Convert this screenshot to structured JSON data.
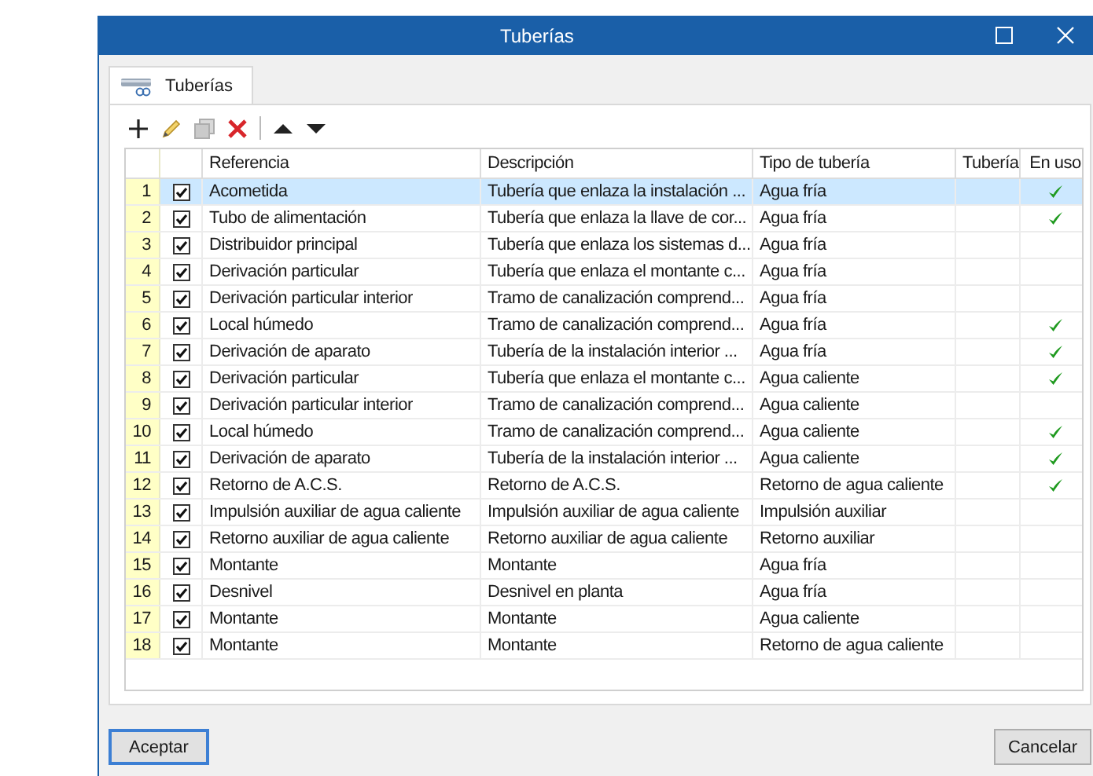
{
  "window": {
    "title": "Tuberías"
  },
  "tabs": [
    {
      "label": "Tuberías",
      "selected": true
    }
  ],
  "toolbar": [
    {
      "kind": "add",
      "disabled": false
    },
    {
      "kind": "edit",
      "disabled": false
    },
    {
      "kind": "copy",
      "disabled": true
    },
    {
      "kind": "delete",
      "disabled": false
    },
    {
      "kind": "separator"
    },
    {
      "kind": "up",
      "disabled": false
    },
    {
      "kind": "down",
      "disabled": false
    }
  ],
  "table": {
    "columns": [
      "Referencia",
      "Descripción",
      "Tipo de tubería",
      "Tubería",
      "En uso"
    ],
    "rows": [
      {
        "number": "1",
        "checked": true,
        "selected": true,
        "reference": "Acometida",
        "description": "Tubería que enlaza la instalación ...",
        "type": "Agua fría",
        "in_use": true
      },
      {
        "number": "2",
        "checked": true,
        "selected": false,
        "reference": "Tubo de alimentación",
        "description": "Tubería que enlaza la llave de cor...",
        "type": "Agua fría",
        "in_use": true
      },
      {
        "number": "3",
        "checked": true,
        "selected": false,
        "reference": "Distribuidor principal",
        "description": "Tubería que enlaza los sistemas d...",
        "type": "Agua fría",
        "in_use": false
      },
      {
        "number": "4",
        "checked": true,
        "selected": false,
        "reference": "Derivación particular",
        "description": "Tubería que enlaza el montante c...",
        "type": "Agua fría",
        "in_use": false
      },
      {
        "number": "5",
        "checked": true,
        "selected": false,
        "reference": "Derivación particular interior",
        "description": "Tramo de canalización comprend...",
        "type": "Agua fría",
        "in_use": false
      },
      {
        "number": "6",
        "checked": true,
        "selected": false,
        "reference": "Local húmedo",
        "description": "Tramo de canalización comprend...",
        "type": "Agua fría",
        "in_use": true
      },
      {
        "number": "7",
        "checked": true,
        "selected": false,
        "reference": "Derivación de aparato",
        "description": "Tubería de la instalación interior ...",
        "type": "Agua fría",
        "in_use": true
      },
      {
        "number": "8",
        "checked": true,
        "selected": false,
        "reference": "Derivación particular",
        "description": "Tubería que enlaza el montante c...",
        "type": "Agua caliente",
        "in_use": true
      },
      {
        "number": "9",
        "checked": true,
        "selected": false,
        "reference": "Derivación particular interior",
        "description": "Tramo de canalización comprend...",
        "type": "Agua caliente",
        "in_use": false
      },
      {
        "number": "10",
        "checked": true,
        "selected": false,
        "reference": "Local húmedo",
        "description": "Tramo de canalización comprend...",
        "type": "Agua caliente",
        "in_use": true
      },
      {
        "number": "11",
        "checked": true,
        "selected": false,
        "reference": "Derivación de aparato",
        "description": "Tubería de la instalación interior ...",
        "type": "Agua caliente",
        "in_use": true
      },
      {
        "number": "12",
        "checked": true,
        "selected": false,
        "reference": "Retorno de A.C.S.",
        "description": "Retorno de A.C.S.",
        "type": "Retorno de agua caliente",
        "in_use": true
      },
      {
        "number": "13",
        "checked": true,
        "selected": false,
        "reference": "Impulsión auxiliar de agua caliente",
        "description": "Impulsión auxiliar de agua caliente",
        "type": "Impulsión auxiliar",
        "in_use": false
      },
      {
        "number": "14",
        "checked": true,
        "selected": false,
        "reference": "Retorno auxiliar de agua caliente",
        "description": "Retorno auxiliar de agua caliente",
        "type": "Retorno auxiliar",
        "in_use": false
      },
      {
        "number": "15",
        "checked": true,
        "selected": false,
        "reference": "Montante",
        "description": "Montante",
        "type": "Agua fría",
        "in_use": false
      },
      {
        "number": "16",
        "checked": true,
        "selected": false,
        "reference": "Desnivel",
        "description": "Desnivel en planta",
        "type": "Agua fría",
        "in_use": false
      },
      {
        "number": "17",
        "checked": true,
        "selected": false,
        "reference": "Montante",
        "description": "Montante",
        "type": "Agua caliente",
        "in_use": false
      },
      {
        "number": "18",
        "checked": true,
        "selected": false,
        "reference": "Montante",
        "description": "Montante",
        "type": "Retorno de agua caliente",
        "in_use": false
      }
    ]
  },
  "buttons": [
    "Aceptar",
    "Cancelar"
  ]
}
